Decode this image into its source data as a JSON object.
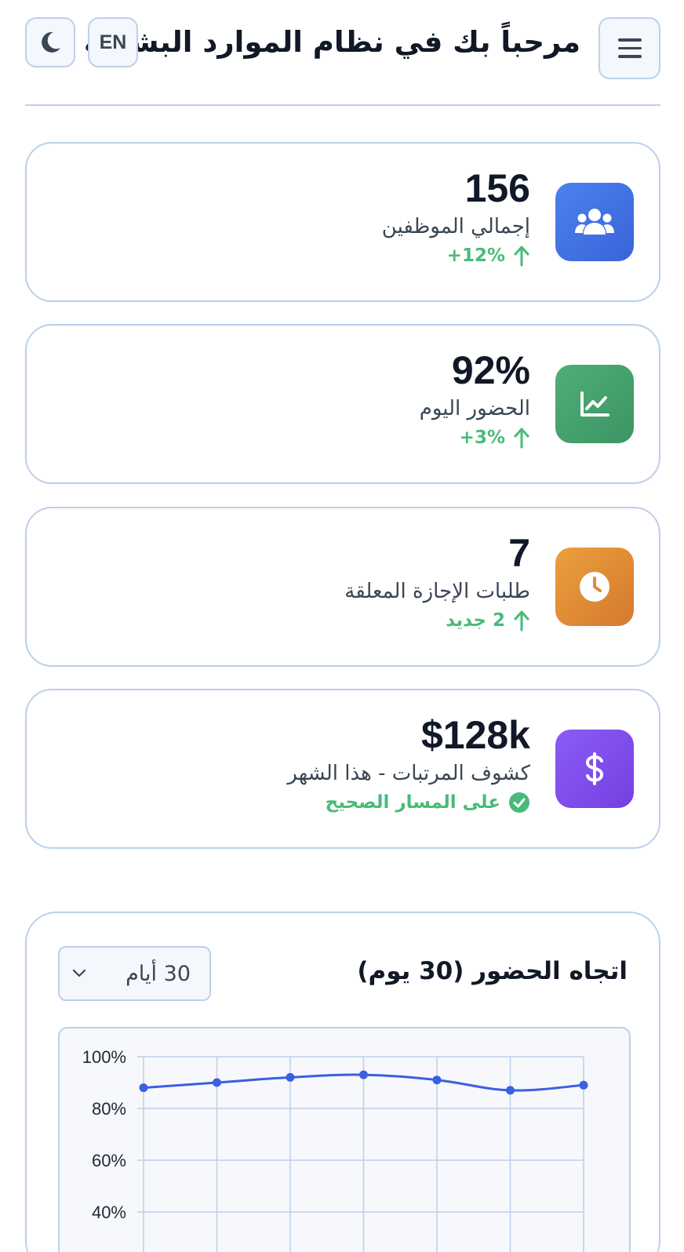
{
  "header": {
    "title": "مرحباً بك في نظام الموارد البشرية",
    "language_label": "EN",
    "menu_icon": "hamburger-icon",
    "theme_icon": "moon-icon"
  },
  "stats": [
    {
      "value": "156",
      "label": "إجمالي الموظفين",
      "trend": "+12%",
      "trend_icon": "arrow-up-icon",
      "icon": "users-icon",
      "color": "#3f6fe3"
    },
    {
      "value": "92%",
      "label": "الحضور اليوم",
      "trend": "+3%",
      "trend_icon": "arrow-up-icon",
      "icon": "chart-line-icon",
      "color": "#45a26e"
    },
    {
      "value": "7",
      "label": "طلبات الإجازة المعلقة",
      "trend": "2 جديد",
      "trend_icon": "arrow-up-icon",
      "icon": "clock-icon",
      "color": "#e08a35"
    },
    {
      "value": "$128k",
      "label": "كشوف المرتبات - هذا الشهر",
      "trend": "على المسار الصحيح",
      "trend_icon": "check-circle-icon",
      "icon": "dollar-icon",
      "color": "#7c4ae8"
    }
  ],
  "colors": {
    "accent": "#3b5fe0",
    "success": "#48bb78",
    "border": "#bcd0ea"
  },
  "attendance": {
    "title": "اتجاه الحضور (30 يوم)",
    "range_selected": "30 أيام",
    "chart_data": {
      "type": "line",
      "title": "",
      "xlabel": "",
      "ylabel": "",
      "y_ticks": [
        "100%",
        "80%",
        "60%",
        "40%"
      ],
      "ylim": [
        40,
        100
      ],
      "grid": true,
      "series": [
        {
          "values": [
            88,
            90,
            92,
            93,
            91,
            87,
            89
          ]
        }
      ]
    }
  }
}
